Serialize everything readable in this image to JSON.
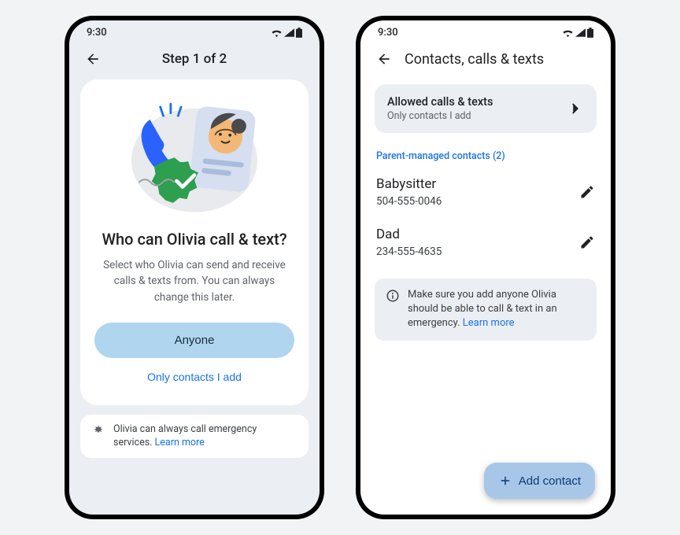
{
  "left": {
    "time": "9:30",
    "step_label": "Step 1 of 2",
    "question_title": "Who can Olivia call & text?",
    "question_sub": "Select who Olivia can send and receive calls & texts from. You can always change this later.",
    "anyone_label": "Anyone",
    "only_contacts_label": "Only contacts I add",
    "notice_text": "Olivia can always call emergency services. ",
    "notice_link": "Learn more"
  },
  "right": {
    "time": "9:30",
    "title": "Contacts, calls & texts",
    "allowed_title": "Allowed calls & texts",
    "allowed_sub": "Only contacts I add",
    "section_label": "Parent-managed contacts (2)",
    "contacts": [
      {
        "name": "Babysitter",
        "phone": "504-555-0046"
      },
      {
        "name": "Dad",
        "phone": "234-555-4635"
      }
    ],
    "info_text": "Make sure you add anyone Olivia should be able to call & text in an emergency. ",
    "info_link": "Learn more",
    "fab_label": "Add contact"
  }
}
